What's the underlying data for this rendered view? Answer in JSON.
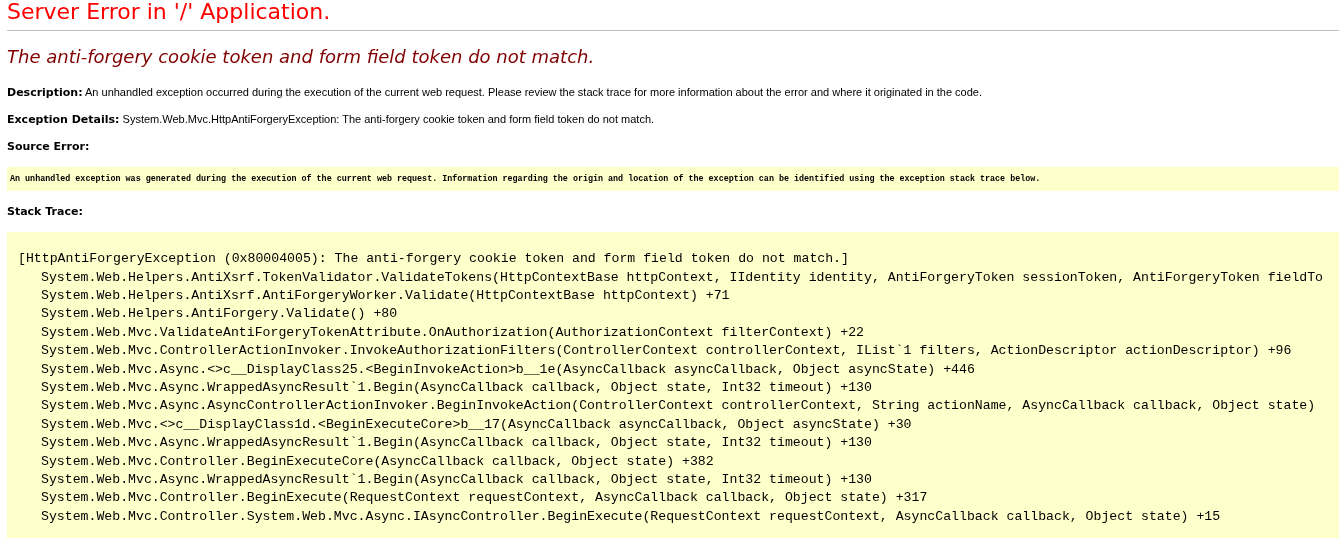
{
  "title": "Server Error in '/' Application.",
  "error_message": "The anti-forgery cookie token and form field token do not match.",
  "description": {
    "label": "Description:",
    "text": "An unhandled exception occurred during the execution of the current web request. Please review the stack trace for more information about the error and where it originated in the code."
  },
  "exception_details": {
    "label": "Exception Details:",
    "text": "System.Web.Mvc.HttpAntiForgeryException: The anti-forgery cookie token and form field token do not match."
  },
  "source_error": {
    "label": "Source Error:",
    "text": "An unhandled exception was generated during the execution of the current web request. Information regarding the origin and location of the exception can be identified using the exception stack trace below."
  },
  "stack_trace": {
    "label": "Stack Trace:",
    "lines": [
      {
        "kind": "header",
        "text": "[HttpAntiForgeryException (0x80004005): The anti-forgery cookie token and form field token do not match.]"
      },
      {
        "kind": "frame",
        "text": "System.Web.Helpers.AntiXsrf.TokenValidator.ValidateTokens(HttpContextBase httpContext, IIdentity identity, AntiForgeryToken sessionToken, AntiForgeryToken fieldTo"
      },
      {
        "kind": "frame",
        "text": "System.Web.Helpers.AntiXsrf.AntiForgeryWorker.Validate(HttpContextBase httpContext) +71"
      },
      {
        "kind": "frame",
        "text": "System.Web.Helpers.AntiForgery.Validate() +80"
      },
      {
        "kind": "frame",
        "text": "System.Web.Mvc.ValidateAntiForgeryTokenAttribute.OnAuthorization(AuthorizationContext filterContext) +22"
      },
      {
        "kind": "frame",
        "text": "System.Web.Mvc.ControllerActionInvoker.InvokeAuthorizationFilters(ControllerContext controllerContext, IList`1 filters, ActionDescriptor actionDescriptor) +96"
      },
      {
        "kind": "frame",
        "text": "System.Web.Mvc.Async.<>c__DisplayClass25.<BeginInvokeAction>b__1e(AsyncCallback asyncCallback, Object asyncState) +446"
      },
      {
        "kind": "frame",
        "text": "System.Web.Mvc.Async.WrappedAsyncResult`1.Begin(AsyncCallback callback, Object state, Int32 timeout) +130"
      },
      {
        "kind": "frame",
        "text": "System.Web.Mvc.Async.AsyncControllerActionInvoker.BeginInvokeAction(ControllerContext controllerContext, String actionName, AsyncCallback callback, Object state)"
      },
      {
        "kind": "frame",
        "text": "System.Web.Mvc.<>c__DisplayClass1d.<BeginExecuteCore>b__17(AsyncCallback asyncCallback, Object asyncState) +30"
      },
      {
        "kind": "frame",
        "text": "System.Web.Mvc.Async.WrappedAsyncResult`1.Begin(AsyncCallback callback, Object state, Int32 timeout) +130"
      },
      {
        "kind": "frame",
        "text": "System.Web.Mvc.Controller.BeginExecuteCore(AsyncCallback callback, Object state) +382"
      },
      {
        "kind": "frame",
        "text": "System.Web.Mvc.Async.WrappedAsyncResult`1.Begin(AsyncCallback callback, Object state, Int32 timeout) +130"
      },
      {
        "kind": "frame",
        "text": "System.Web.Mvc.Controller.BeginExecute(RequestContext requestContext, AsyncCallback callback, Object state) +317"
      },
      {
        "kind": "frame",
        "text": "System.Web.Mvc.Controller.System.Web.Mvc.Async.IAsyncController.BeginExecute(RequestContext requestContext, AsyncCallback callback, Object state) +15"
      }
    ]
  }
}
